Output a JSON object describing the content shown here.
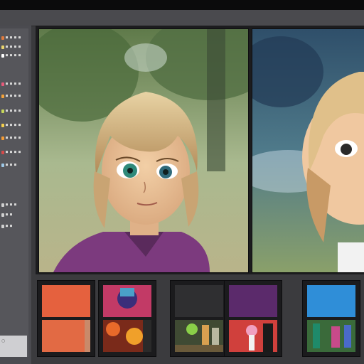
{
  "window": {
    "accent": "#e3653f"
  },
  "sidebar": {
    "items": [
      {
        "label": "■ ■ ■ ■",
        "color": "#e07a3c"
      },
      {
        "label": "■ ■ ■ ■",
        "color": "#e9d46c"
      },
      {
        "label": "■ ■ ■ ■",
        "color": "#ffffff"
      },
      {
        "label": "■ ■ ■ ■",
        "color": "#e65a7a"
      },
      {
        "label": "■ ■ ■ ■",
        "color": "#f4a23a"
      },
      {
        "label": "■ ■ ■ ■",
        "color": "#c7d75a"
      },
      {
        "label": "■ ■ ■ ■",
        "color": "#f4d04d"
      },
      {
        "label": "■ ■ ■ ■",
        "color": "#f49b34"
      },
      {
        "label": "■ ■ ■ ■",
        "color": "#d64a4a"
      },
      {
        "label": "■ ■ ■",
        "color": "#9ec9e8"
      },
      {
        "label": "■ ■ ■",
        "color": "#d0d0d0"
      },
      {
        "label": "■ ■",
        "color": "#d0d0d0"
      },
      {
        "label": "■ ■",
        "color": "#d0d0d0"
      }
    ],
    "footer_label": "○"
  },
  "viewer": {
    "images": [
      {
        "icon": "portrait-image-icon"
      },
      {
        "icon": "portrait-image-icon"
      }
    ]
  },
  "thumbnails": [
    {
      "icon": "swatch-orange-icon",
      "colors": [
        "#e5613e",
        "#e26a44"
      ]
    },
    {
      "icon": "abstract-art-icon",
      "colors": [
        "#c23a66",
        "#3a2e7a"
      ]
    },
    {
      "icon": "street-scene-icon",
      "colors": [
        "#2f2f31",
        "#3f4a33"
      ]
    },
    {
      "icon": "purple-scene-icon",
      "colors": [
        "#5b2a6b",
        "#d0403c"
      ]
    },
    {
      "icon": "blue-scene-icon",
      "colors": [
        "#2f8ed8",
        "#3a6a3a"
      ]
    }
  ]
}
